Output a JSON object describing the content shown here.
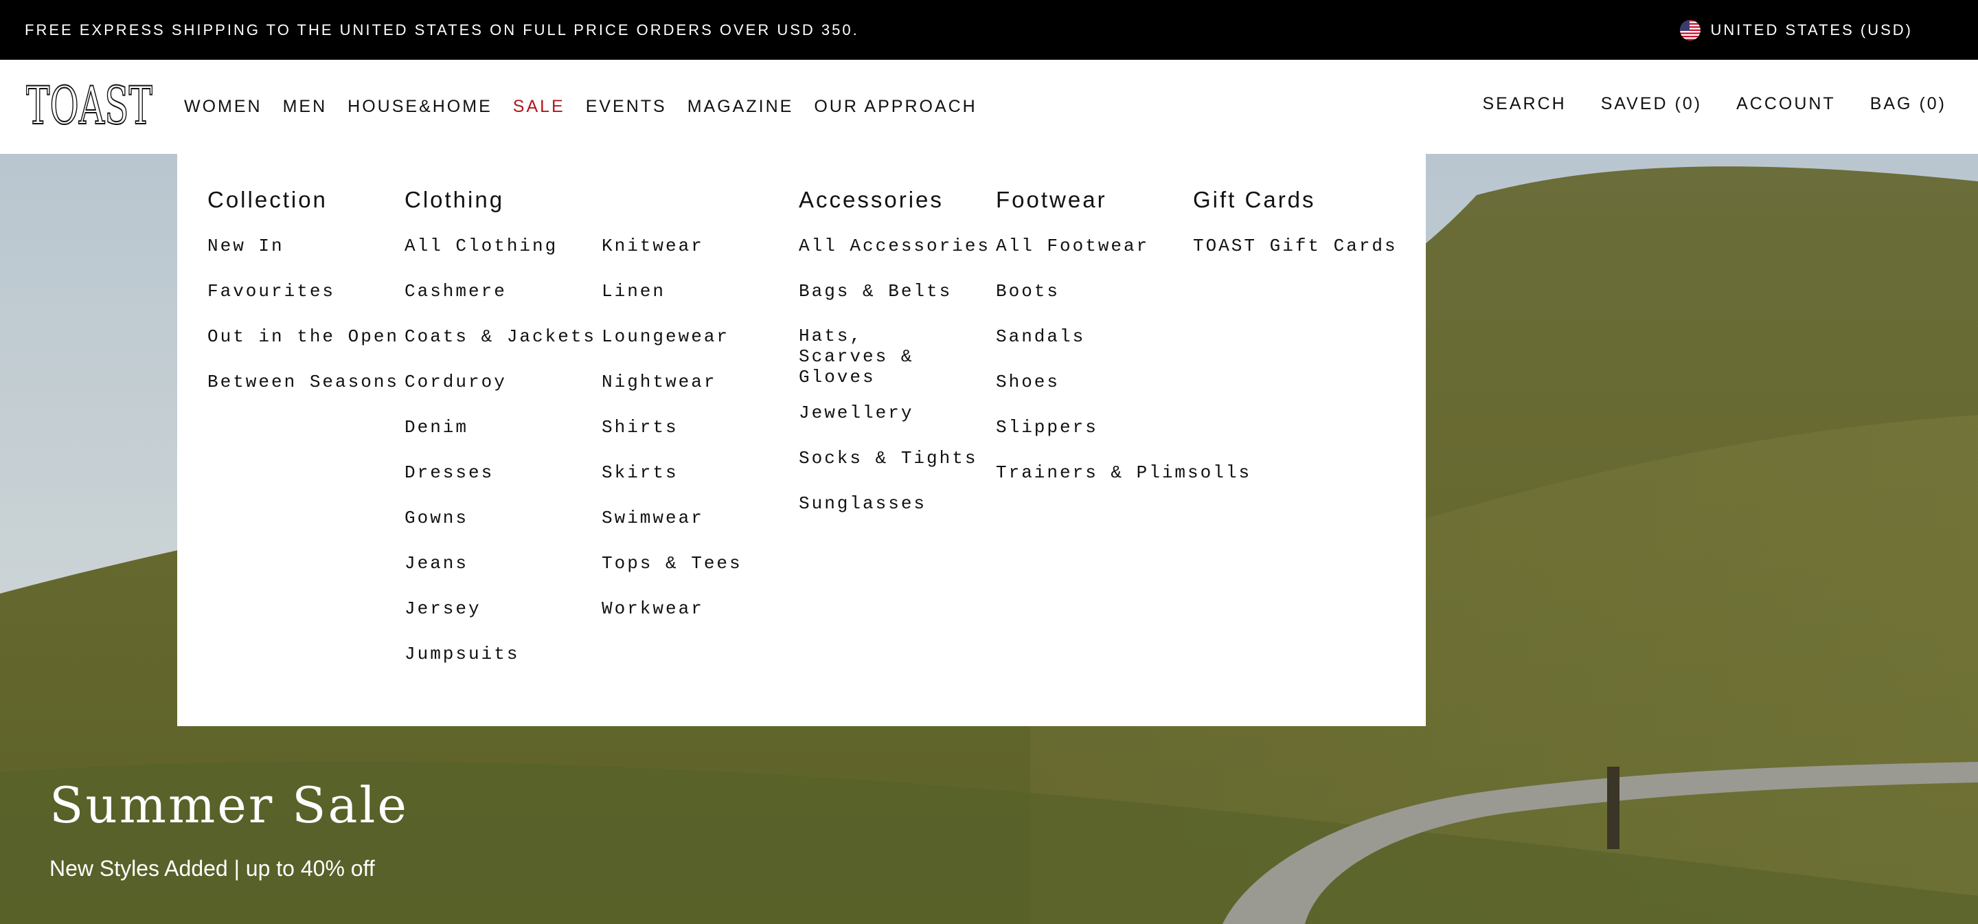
{
  "announcement": {
    "text": "FREE EXPRESS SHIPPING TO THE UNITED STATES ON FULL PRICE ORDERS OVER USD 350.",
    "region": "UNITED STATES (USD)",
    "region_icon": "us-flag-icon"
  },
  "brand": {
    "logo_text": "TOAST"
  },
  "nav": {
    "items": [
      "WOMEN",
      "MEN",
      "HOUSE&HOME",
      "SALE",
      "EVENTS",
      "MAGAZINE",
      "OUR APPROACH"
    ],
    "sale_color": "#b3151d"
  },
  "utility": {
    "search": "SEARCH",
    "saved": "SAVED (0)",
    "account": "ACCOUNT",
    "bag": "BAG (0)"
  },
  "menu": {
    "collection": {
      "title": "Collection",
      "items": [
        "New In",
        "Favourites",
        "Out in the Open",
        "Between Seasons"
      ]
    },
    "clothing": {
      "title": "Clothing",
      "items_a": [
        "All Clothing",
        "Cashmere",
        "Coats & Jackets",
        "Corduroy",
        "Denim",
        "Dresses",
        "Gowns",
        "Jeans",
        "Jersey",
        "Jumpsuits"
      ],
      "items_b": [
        "Knitwear",
        "Linen",
        "Loungewear",
        "Nightwear",
        "Shirts",
        "Skirts",
        "Swimwear",
        "Tops & Tees",
        "Workwear"
      ]
    },
    "accessories": {
      "title": "Accessories",
      "items": [
        "All Accessories",
        "Bags & Belts",
        "Hats, Scarves & Gloves",
        "Jewellery",
        "Socks & Tights",
        "Sunglasses"
      ]
    },
    "footwear": {
      "title": "Footwear",
      "items": [
        "All Footwear",
        "Boots",
        "Sandals",
        "Shoes",
        "Slippers",
        "Trainers & Plimsolls"
      ]
    },
    "giftcards": {
      "title": "Gift Cards",
      "items": [
        "TOAST Gift Cards"
      ]
    }
  },
  "hero": {
    "title": "Summer Sale",
    "subtitle": "New Styles Added | up to 40% off"
  }
}
